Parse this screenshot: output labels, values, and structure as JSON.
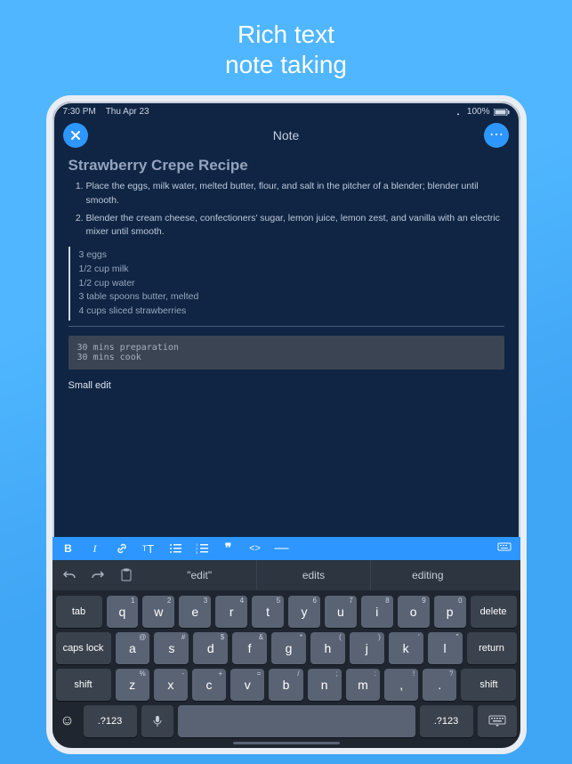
{
  "promo": {
    "l1": "Rich text",
    "l2": "note taking"
  },
  "status": {
    "time": "7:30 PM",
    "date": "Thu Apr 23",
    "battery": "100%"
  },
  "nav": {
    "title": "Note"
  },
  "note": {
    "title": "Strawberry Crepe Recipe",
    "steps": [
      "Place the eggs, milk water, melted butter, flour, and salt in the pitcher of a blender; blender until smooth.",
      "Blender the cream cheese, confectioners' sugar, lemon juice, lemon zest, and vanilla with an electric mixer until smooth."
    ],
    "ingredients": [
      "3 eggs",
      "1/2 cup milk",
      "1/2 cup water",
      "3 table spoons butter, melted",
      "4 cups sliced strawberries"
    ],
    "code": "30 mins preparation\n30 mins cook",
    "plain": "Small edit"
  },
  "fmt": {
    "bold": "B",
    "italic": "I",
    "link": "link-icon",
    "textsize": "tT",
    "ulist": "ul-icon",
    "olist": "ol-icon",
    "quote": "\"\"",
    "code": "<>",
    "hr": "—",
    "keyboard": "keyboard-icon"
  },
  "sug": {
    "w1": "\"edit\"",
    "w2": "edits",
    "w3": "editing"
  },
  "kbd": {
    "row1": [
      {
        "m": "q",
        "s": "1"
      },
      {
        "m": "w",
        "s": "2"
      },
      {
        "m": "e",
        "s": "3"
      },
      {
        "m": "r",
        "s": "4"
      },
      {
        "m": "t",
        "s": "5"
      },
      {
        "m": "y",
        "s": "6"
      },
      {
        "m": "u",
        "s": "7"
      },
      {
        "m": "i",
        "s": "8"
      },
      {
        "m": "o",
        "s": "9"
      },
      {
        "m": "p",
        "s": "0"
      }
    ],
    "row2": [
      {
        "m": "a",
        "s": "@"
      },
      {
        "m": "s",
        "s": "#"
      },
      {
        "m": "d",
        "s": "$"
      },
      {
        "m": "f",
        "s": "&"
      },
      {
        "m": "g",
        "s": "*"
      },
      {
        "m": "h",
        "s": "("
      },
      {
        "m": "j",
        "s": ")"
      },
      {
        "m": "k",
        "s": "'"
      },
      {
        "m": "l",
        "s": "\""
      }
    ],
    "row3": [
      {
        "m": "z",
        "s": "%"
      },
      {
        "m": "x",
        "s": "-"
      },
      {
        "m": "c",
        "s": "+"
      },
      {
        "m": "v",
        "s": "="
      },
      {
        "m": "b",
        "s": "/"
      },
      {
        "m": "n",
        "s": ";"
      },
      {
        "m": "m",
        "s": ":"
      },
      {
        "m": ",",
        "s": "!"
      },
      {
        "m": ".",
        "s": "?"
      }
    ],
    "labels": {
      "tab": "tab",
      "delete": "delete",
      "caps": "caps lock",
      "return": "return",
      "shift": "shift",
      "numsym": ".?123"
    }
  }
}
